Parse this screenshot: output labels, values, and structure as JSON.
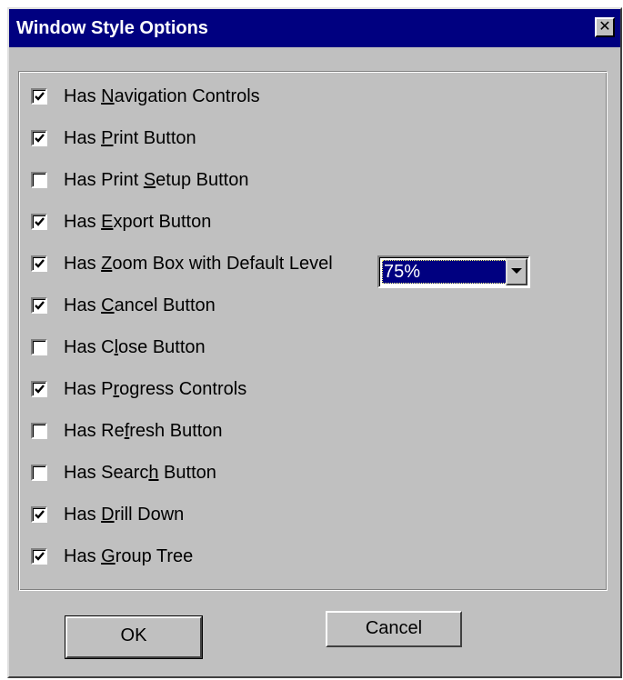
{
  "window": {
    "title": "Window Style Options",
    "close_glyph": "✕"
  },
  "options": [
    {
      "pre": "Has ",
      "key": "N",
      "post": "avigation Controls",
      "checked": true
    },
    {
      "pre": "Has ",
      "key": "P",
      "post": "rint Button",
      "checked": true
    },
    {
      "pre": "Has Print ",
      "key": "S",
      "post": "etup Button",
      "checked": false
    },
    {
      "pre": "Has ",
      "key": "E",
      "post": "xport Button",
      "checked": true
    },
    {
      "pre": "Has ",
      "key": "Z",
      "post": "oom Box with Default Level",
      "checked": true
    },
    {
      "pre": "Has ",
      "key": "C",
      "post": "ancel Button",
      "checked": true
    },
    {
      "pre": "Has C",
      "key": "l",
      "post": "ose Button",
      "checked": false
    },
    {
      "pre": "Has P",
      "key": "r",
      "post": "ogress Controls",
      "checked": true
    },
    {
      "pre": "Has Re",
      "key": "f",
      "post": "resh Button",
      "checked": false
    },
    {
      "pre": "Has Searc",
      "key": "h",
      "post": " Button",
      "checked": false
    },
    {
      "pre": "Has ",
      "key": "D",
      "post": "rill Down",
      "checked": true
    },
    {
      "pre": "Has ",
      "key": "G",
      "post": "roup Tree",
      "checked": true
    }
  ],
  "zoom": {
    "selected": "75%"
  },
  "buttons": {
    "ok_label": "OK",
    "cancel_label": "Cancel"
  },
  "colors": {
    "titlebar": "#000080",
    "face": "#c0c0c0",
    "selection": "#000080"
  },
  "icons": {
    "check": "check-icon",
    "close": "close-icon",
    "dropdown": "chevron-down-icon"
  }
}
